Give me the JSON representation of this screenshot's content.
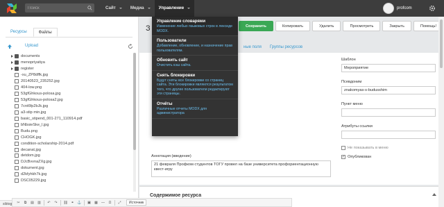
{
  "topbar": {
    "search_placeholder": "Поиск",
    "nav": [
      {
        "label": "Сайт"
      },
      {
        "label": "Медиа"
      },
      {
        "label": "Управление"
      }
    ],
    "user_name": "profcom"
  },
  "manage_menu": [
    {
      "title": "Управление словарями",
      "desc": "Изменение любых языковых строк в лексиде MODX."
    },
    {
      "title": "Пользователи",
      "desc": "Добавление, обновление, и назначение прав пользователям."
    },
    {
      "title": "Обновить сайт",
      "desc": "Очистить кэш сайта."
    },
    {
      "title": "Снять блокировки",
      "desc": "Будут сняты все блокировки со страниц сайта. Эти блокировки являются результатом того, что другие пользователи редактируют эти страницы."
    },
    {
      "title": "Отчёты",
      "desc": "Различные отчеты MODX для администратора"
    }
  ],
  "left_panel": {
    "tabs": [
      "Ресурсы",
      "Файлы"
    ],
    "upload_label": "Upload",
    "files": [
      {
        "name": "documents",
        "type": "folder",
        "child": false
      },
      {
        "name": "menopriyatiya",
        "type": "folder",
        "child": false
      },
      {
        "name": "register",
        "type": "folder",
        "child": false
      },
      {
        "name": "-xu_ZP8dffk.jpg",
        "type": "file",
        "child": true
      },
      {
        "name": "20140523_235252.jpg",
        "type": "file",
        "child": true
      },
      {
        "name": "404-low.png",
        "type": "file",
        "child": true
      },
      {
        "name": "53gfGhkous-polosa.jpg",
        "type": "file",
        "child": true
      },
      {
        "name": "53gfGhkous-polosa2.jpg",
        "type": "file",
        "child": true
      },
      {
        "name": "7cnt6fp2bJk.jpg",
        "type": "file",
        "child": true
      },
      {
        "name": "a3-stip min.jpg",
        "type": "file",
        "child": true
      },
      {
        "name": "basic_stipend_001-271_110914.pdf",
        "type": "file",
        "child": true
      },
      {
        "name": "bNbsieSke_l.jpg",
        "type": "file",
        "child": true
      },
      {
        "name": "Budu.png",
        "type": "file",
        "child": true
      },
      {
        "name": "CHOGK.jpg",
        "type": "file",
        "child": true
      },
      {
        "name": "condition-scholarship-2014.pdf",
        "type": "file",
        "child": true
      },
      {
        "name": "decanat.jpg",
        "type": "file",
        "child": true
      },
      {
        "name": "detdom.jpg",
        "type": "file",
        "child": true
      },
      {
        "name": "DJcBvvnaZXg.jpg",
        "type": "file",
        "child": true
      },
      {
        "name": "dokument.jpg",
        "type": "file",
        "child": true
      },
      {
        "name": "d2kfyhkh7k.jpg",
        "type": "file",
        "child": true
      },
      {
        "name": "DSC05229.jpg",
        "type": "file",
        "child": true
      }
    ],
    "status_url": "sibtogu.ru/manager/?a=workspaces/lexicon"
  },
  "main": {
    "title_partial": "З",
    "toolbar": [
      {
        "label": "Сохранить",
        "primary": true
      },
      {
        "label": "Копировать",
        "primary": false
      },
      {
        "label": "Удалить",
        "primary": false
      },
      {
        "label": "Просмотреть",
        "primary": false
      },
      {
        "label": "Закрыть",
        "primary": false
      },
      {
        "label": "Помощь!",
        "primary": false
      }
    ],
    "subtabs": [
      "ные поля",
      "Группы ресурсов"
    ],
    "template_label": "Шаблон",
    "template_value": "Мероприятие",
    "alias_label": "Псевдоним",
    "alias_value": "znakomyas-s-budusshim",
    "menu_item_label": "Пункт меню",
    "link_attrs_label": "Атрибуты ссылки",
    "hide_menu_label": "Не показывать в меню",
    "published_label": "Опубликован",
    "annotation_label": "Аннотация (введение)",
    "annotation_text": "21 февраля Профком студентов ТОГУ провел на базе университета профориентационную квест-игру",
    "content_label": "Содержимое ресурса",
    "editor_source": "Источник"
  }
}
